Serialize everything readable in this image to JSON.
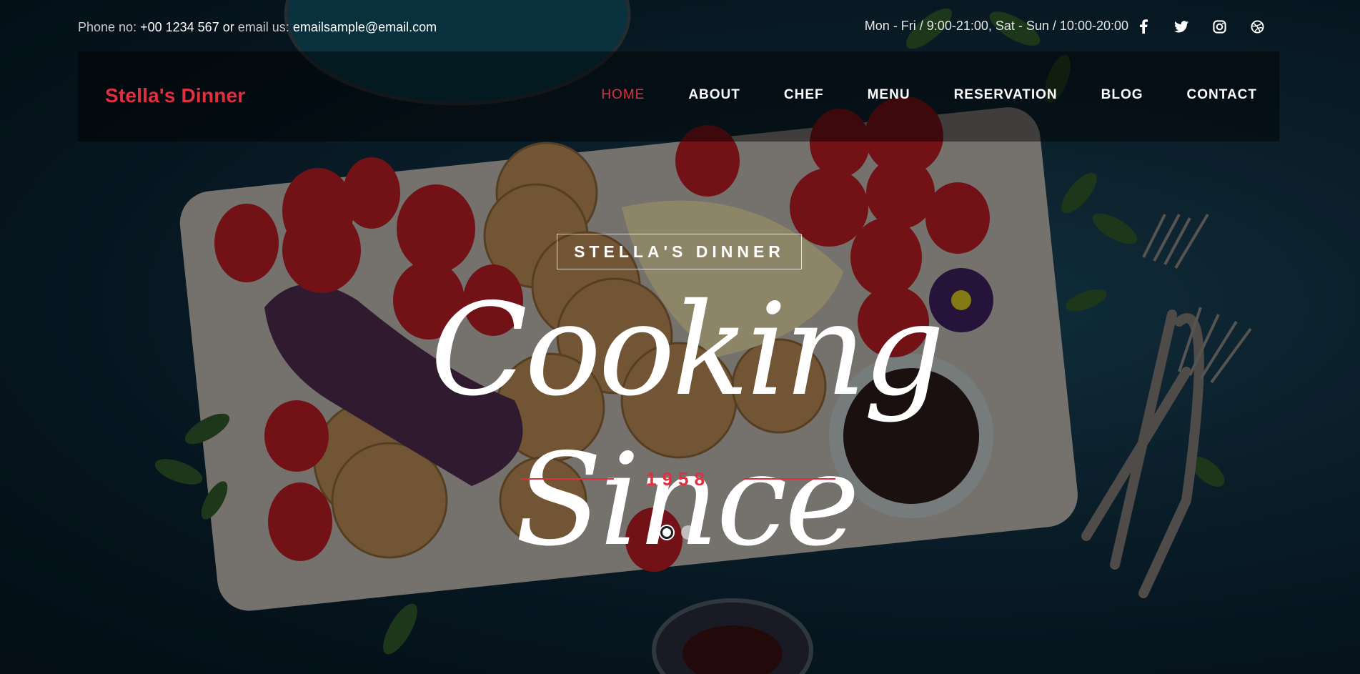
{
  "topbar": {
    "phone_label": "Phone no:",
    "phone_value": "+00 1234 567",
    "or_text": "or",
    "email_label": "email us:",
    "email_value": "emailsample@email.com",
    "hours": "Mon - Fri / 9:00-21:00, Sat - Sun / 10:00-20:00",
    "social": [
      {
        "icon": "facebook-icon"
      },
      {
        "icon": "twitter-icon"
      },
      {
        "icon": "instagram-icon"
      },
      {
        "icon": "dribbble-icon"
      }
    ]
  },
  "navbar": {
    "brand": "Stella's Dinner",
    "items": [
      {
        "label": "HOME",
        "active": true
      },
      {
        "label": "ABOUT"
      },
      {
        "label": "CHEF"
      },
      {
        "label": "MENU"
      },
      {
        "label": "RESERVATION"
      },
      {
        "label": "BLOG"
      },
      {
        "label": "CONTACT"
      }
    ]
  },
  "hero": {
    "eyebrow": "STELLA'S DINNER",
    "headline": "Cooking Since",
    "year": "1958",
    "slides": 2,
    "active_slide": 1
  },
  "colors": {
    "accent": "#e03040",
    "text": "#ffffff",
    "muted": "#c9c9c9"
  }
}
